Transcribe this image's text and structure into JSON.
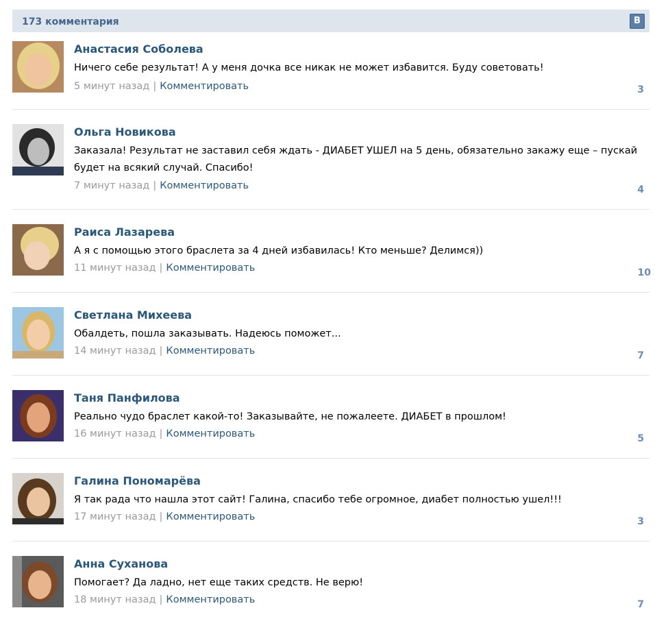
{
  "header": {
    "title": "173 комментария",
    "logo_letter": "B"
  },
  "reply_label": "Комментировать",
  "separator": "|",
  "comments": [
    {
      "name": "Анастасия Соболева",
      "text": "Ничего себе результат! А у меня дочка все никак не может избавится. Буду советовать!",
      "time": "5 минут назад",
      "likes": "3",
      "avatar": {
        "bg": "#b7895f",
        "hair": "#e6d08a",
        "skin": "#f0c49f"
      }
    },
    {
      "name": "Ольга Новикова",
      "text": "Заказала! Результат не заставил себя ждать - ДИАБЕТ УШЕЛ на 5 день, обязательно закажу еще – пускай будет на всякий случай. Спасибо!",
      "time": "7 минут назад",
      "likes": "4",
      "avatar": {
        "bg": "#e2e2e2",
        "hair": "#2a2a2a",
        "skin": "#bdbdbd"
      }
    },
    {
      "name": "Раиса Лазарева",
      "text": "А я с помощью этого браслета за 4 дней избавилась! Кто меньше? Делимся))",
      "time": "11 минут назад",
      "likes": "10",
      "avatar": {
        "bg": "#8a6a4a",
        "hair": "#e8cf8c",
        "skin": "#f1d2b6"
      }
    },
    {
      "name": "Светлана Михеева",
      "text": "Обалдеть, пошла заказывать. Надеюсь поможет...",
      "time": "14 минут назад",
      "likes": "7",
      "avatar": {
        "bg": "#9cc6e2",
        "hair": "#d8b76b",
        "skin": "#f2cda8"
      }
    },
    {
      "name": "Таня Панфилова",
      "text": "Реально чудо браслет какой-то! Заказывайте, не пожалеете. ДИАБЕТ в прошлом!",
      "time": "16 минут назад",
      "likes": "5",
      "avatar": {
        "bg": "#3b2f6b",
        "hair": "#7a3b1e",
        "skin": "#e3a47c"
      }
    },
    {
      "name": "Галина Пономарёва",
      "text": "Я так рада что нашла этот сайт! Галина, спасибо тебе огромное, диабет полностью ушел!!!",
      "time": "17 минут назад",
      "likes": "3",
      "avatar": {
        "bg": "#d7d3cc",
        "hair": "#5a3a1f",
        "skin": "#eac3a0"
      }
    },
    {
      "name": "Анна Суханова",
      "text": "Помогает? Да ладно, нет еще таких средств. Не верю!",
      "time": "18 минут назад",
      "likes": "7",
      "avatar": {
        "bg": "#5a5a5a",
        "hair": "#7b4a2a",
        "skin": "#e8b48e"
      }
    }
  ]
}
